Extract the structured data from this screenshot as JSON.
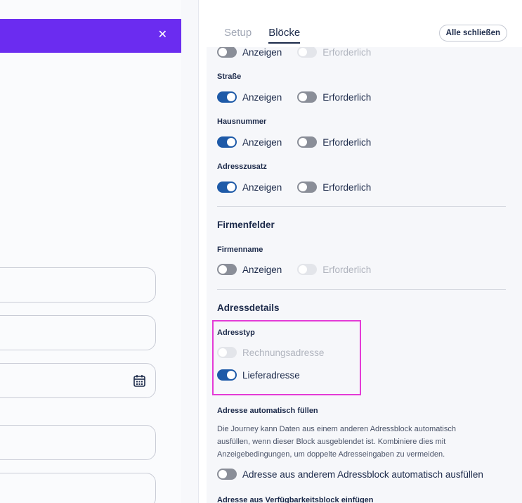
{
  "preview": {
    "close_icon": "close-icon",
    "calendar_icon": "calendar-icon",
    "header_color": "#6b2cf0"
  },
  "tabs": [
    {
      "label": "Setup",
      "active": false
    },
    {
      "label": "Blöcke",
      "active": true
    }
  ],
  "close_all_label": "Alle schließen",
  "option_labels": {
    "show": "Anzeigen",
    "required": "Erforderlich"
  },
  "address_fields": [
    {
      "label": "",
      "show": false,
      "required": false,
      "required_disabled": true
    },
    {
      "label": "Straße",
      "show": true,
      "required": false
    },
    {
      "label": "Hausnummer",
      "show": true,
      "required": false
    },
    {
      "label": "Adresszusatz",
      "show": true,
      "required": false
    }
  ],
  "company": {
    "title": "Firmenfelder",
    "field_label": "Firmenname",
    "show": false,
    "required": false
  },
  "address_details": {
    "title": "Adressdetails",
    "type_label": "Adresstyp",
    "billing_label": "Rechnungsadresse",
    "billing_on": false,
    "shipping_label": "Lieferadresse",
    "shipping_on": true
  },
  "autofill": {
    "title": "Adresse automatisch füllen",
    "description": "Die Journey kann Daten aus einem anderen Adressblock automatisch ausfüllen, wenn dieser Block ausgeblendet ist. Kombiniere dies mit Anzeigebedingungen, um doppelte Adresseingaben zu vermeiden.",
    "toggle_label": "Adresse aus anderem Adressblock automatisch ausfüllen",
    "toggle_on": false
  },
  "availability_title": "Adresse aus Verfügbarkeitsblock einfügen",
  "colors": {
    "accent": "#1e5aa8",
    "highlight": "#e43bd6"
  }
}
